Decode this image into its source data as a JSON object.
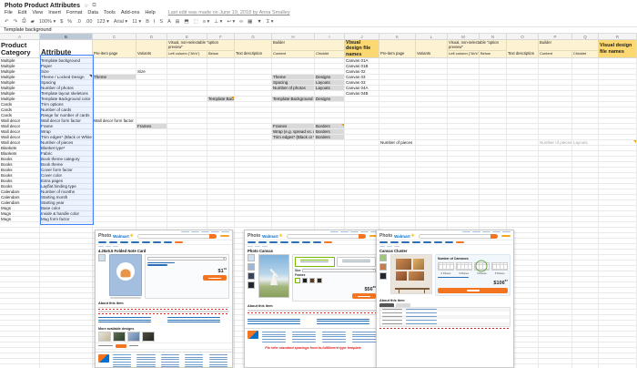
{
  "window": {
    "title": "Photo Product Attributes",
    "menus": [
      "File",
      "Edit",
      "View",
      "Insert",
      "Format",
      "Data",
      "Tools",
      "Add-ons",
      "Help"
    ],
    "last_edit": "Last edit was made on June 19, 2018 by Anna Smalley"
  },
  "toolbar": {
    "items": [
      {
        "g": "↶",
        "n": "undo"
      },
      {
        "g": "↷",
        "n": "redo"
      },
      {
        "g": "⎙",
        "n": "print"
      },
      {
        "g": "▰",
        "n": "paint-format"
      },
      {
        "g": "100% ▾",
        "n": "zoom-select"
      },
      {
        "g": "$",
        "n": "format-currency"
      },
      {
        "g": "%",
        "n": "format-percent"
      },
      {
        "g": ".0",
        "n": "decrease-decimal"
      },
      {
        "g": ".00",
        "n": "increase-decimal"
      },
      {
        "g": "123 ▾",
        "n": "number-format"
      },
      {
        "g": "Arial ▾",
        "n": "font-select"
      },
      {
        "g": "11 ▾",
        "n": "font-size-select"
      },
      {
        "g": "B",
        "n": "bold"
      },
      {
        "g": "I",
        "n": "italic"
      },
      {
        "g": "S",
        "n": "strikethrough"
      },
      {
        "g": "A",
        "n": "text-color"
      },
      {
        "g": "⊞",
        "n": "borders"
      },
      {
        "g": "⬒",
        "n": "fill-color"
      },
      {
        "g": "⬚",
        "n": "merge-cells"
      },
      {
        "g": "≡ ▾",
        "n": "horizontal-align"
      },
      {
        "g": "⊥ ▾",
        "n": "vertical-align"
      },
      {
        "g": "↩ ▾",
        "n": "text-wrap"
      },
      {
        "g": "∞",
        "n": "insert-link"
      },
      {
        "g": "▦",
        "n": "insert-chart"
      },
      {
        "g": "▼",
        "n": "filter"
      },
      {
        "g": "Σ ▾",
        "n": "functions"
      }
    ]
  },
  "formula_bar": {
    "value": "Template background"
  },
  "sheet": {
    "col_letters": [
      "A",
      "B",
      "C",
      "D",
      "E",
      "F",
      "G",
      "H",
      "I",
      "J",
      "K",
      "L",
      "M",
      "N",
      "O",
      "P",
      "Q",
      "R"
    ],
    "selected_col": "B",
    "headers": {
      "product_category": "Product Category",
      "attribute": "Attribute",
      "pre_item_page": "Pre-item page",
      "variants": "Variants",
      "option_preview_group": "Visual, non-selectable \"option preview\"",
      "left_column": "Left column (\"AVs\")",
      "below": "Below",
      "text_description": "Text description",
      "builder": "Builder",
      "content": "Content",
      "chicklet": "Chicklet",
      "visual_design": "Visual design file names"
    },
    "rows": [
      {
        "category": "Multiple",
        "attribute": "Template background",
        "cells": {
          "J": {
            "t": "Canvas 01A"
          }
        }
      },
      {
        "category": "Multiple",
        "attribute": "Paper",
        "cells": {
          "J": {
            "t": "Canvas 01B"
          }
        }
      },
      {
        "category": "Multiple",
        "attribute": "Size",
        "cells": {
          "D": {
            "t": "Size"
          },
          "J": {
            "t": "Canvas 02"
          }
        }
      },
      {
        "category": "Multiple",
        "attribute": "Theme / Locked Design",
        "attr_note": true,
        "cells": {
          "C": {
            "t": "Theme",
            "chip": true
          },
          "H": {
            "t": "Theme",
            "chip": true
          },
          "I": {
            "t": "Designs",
            "chip": true
          },
          "J": {
            "t": "Canvas 03"
          }
        }
      },
      {
        "category": "Multiple",
        "attribute": "Spacing",
        "cells": {
          "H": {
            "t": "Spacing",
            "chip": true
          },
          "I": {
            "t": "Layouts",
            "chip": true
          },
          "J": {
            "t": "Canvas 03"
          }
        }
      },
      {
        "category": "Multiple",
        "attribute": "Number of photos",
        "cells": {
          "H": {
            "t": "Number of photos",
            "chip": true
          },
          "I": {
            "t": "Layouts",
            "chip": true
          },
          "J": {
            "t": "Canvas 04A"
          }
        }
      },
      {
        "category": "Multiple",
        "attribute": "Template layout skeletons",
        "cells": {
          "J": {
            "t": "Canvas 04B"
          }
        }
      },
      {
        "category": "Multiple",
        "attribute": "Template Background color",
        "cells": {
          "F": {
            "t": "Template Background color",
            "chip": true,
            "note": true
          },
          "H": {
            "t": "Template Background col",
            "chip": true
          },
          "I": {
            "t": "Designs",
            "chip": true
          }
        }
      },
      {
        "category": "Cards",
        "attribute": "Trim options",
        "cells": {}
      },
      {
        "category": "Cards",
        "attribute": "Number of cards",
        "cells": {}
      },
      {
        "category": "Cards",
        "attribute": "Range for number of cards",
        "cells": {}
      },
      {
        "category": "Wall decor",
        "attribute": "Wall decor form factor",
        "cells": {
          "C": {
            "t": "Wall decor form factor"
          }
        }
      },
      {
        "category": "Wall decor",
        "attribute": "Frame",
        "cells": {
          "D": {
            "t": "Frames",
            "chip": true
          },
          "H": {
            "t": "Frames",
            "chip": true
          },
          "I": {
            "t": "Borders",
            "chip": true,
            "note": true
          }
        }
      },
      {
        "category": "Wall decor",
        "attribute": "Wrap",
        "cells": {
          "H": {
            "t": "Wrap (e.g. spread vs. mir",
            "chip": true
          },
          "I": {
            "t": "Borders",
            "chip": true
          }
        }
      },
      {
        "category": "Wall decor",
        "attribute": "Trim edges* (Black or White)",
        "cells": {
          "H": {
            "t": "Trim edges* (Black or Wh",
            "chip": true
          },
          "I": {
            "t": "Borders",
            "chip": true
          }
        }
      },
      {
        "category": "Wall decor",
        "attribute": "Number of pieces",
        "cells": {
          "K": {
            "t": "Number of pieces"
          },
          "P": {
            "t": "Number of pieces",
            "muted": true
          },
          "Q": {
            "t": "Layouts",
            "muted": true
          },
          "R": {
            "t": "",
            "note": true
          }
        }
      },
      {
        "category": "Blankets",
        "attribute": "Blanket type*",
        "cells": {}
      },
      {
        "category": "Blankets",
        "attribute": "Fabric",
        "cells": {}
      },
      {
        "category": "Books",
        "attribute": "Book theme category",
        "cells": {}
      },
      {
        "category": "Books",
        "attribute": "Book theme",
        "cells": {}
      },
      {
        "category": "Books",
        "attribute": "Cover form factor",
        "cells": {}
      },
      {
        "category": "Books",
        "attribute": "Cover color",
        "cells": {}
      },
      {
        "category": "Books",
        "attribute": "Extra pages",
        "cells": {}
      },
      {
        "category": "Books",
        "attribute": "Layflat binding type",
        "cells": {}
      },
      {
        "category": "Calendars",
        "attribute": "Number of months",
        "cells": {}
      },
      {
        "category": "Calendars",
        "attribute": "Starting month",
        "cells": {}
      },
      {
        "category": "Calendars",
        "attribute": "Starting year",
        "cells": {}
      },
      {
        "category": "Mugs",
        "attribute": "Base color",
        "cells": {}
      },
      {
        "category": "Mugs",
        "attribute": "Inside & handle color",
        "cells": {}
      },
      {
        "category": "Mugs",
        "attribute": "Mug form factor",
        "cells": {}
      }
    ]
  },
  "colors": {
    "header_cream": "#fdf2d2",
    "header_yellow": "#fbd872",
    "chip_gray": "#d9d9d9",
    "selection_blue": "#4285f4",
    "walmart_blue": "#0071ce",
    "walmart_orange": "#f47521",
    "walmart_yellow": "#ffc220",
    "annotation_red": "#e02020"
  },
  "mockups": [
    {
      "brand": "Photo",
      "store": "Walmart",
      "title": "4.25x5.5 Folded Note Card",
      "price": "$1",
      "price_cents": "19",
      "about_label": "About this item",
      "designs_label": "More available designs"
    },
    {
      "brand": "Photo",
      "store": "Walmart",
      "title": "Photo Canvas",
      "size_label": "Size",
      "frames_label": "Frames",
      "price": "$56",
      "price_cents": "86",
      "about_label": "About this item",
      "note": "Pls refer standard spacings from In-fulfillment type template"
    },
    {
      "brand": "Photo",
      "store": "Walmart",
      "title": "Canvas Cluster",
      "panel_label": "Number of Canvases",
      "options": [
        "2 Pieces",
        "3 Pieces",
        "4 Pieces",
        "5 Pieces"
      ],
      "price": "$106",
      "price_cents": "87",
      "about_label": "About this item"
    }
  ]
}
